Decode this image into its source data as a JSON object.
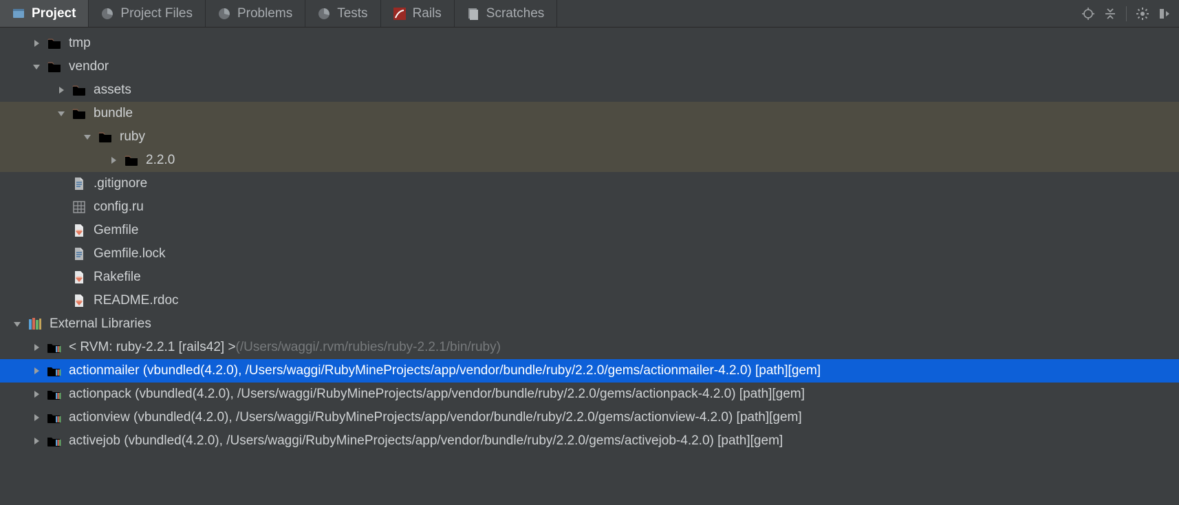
{
  "tabs": {
    "items": [
      {
        "label": "Project",
        "icon": "project-icon",
        "active": true
      },
      {
        "label": "Project Files",
        "icon": "pie-icon",
        "active": false
      },
      {
        "label": "Problems",
        "icon": "pie-icon",
        "active": false
      },
      {
        "label": "Tests",
        "icon": "pie-icon",
        "active": false
      },
      {
        "label": "Rails",
        "icon": "rails-icon",
        "active": false
      },
      {
        "label": "Scratches",
        "icon": "scratches-icon",
        "active": false
      }
    ]
  },
  "tree": {
    "rows": [
      {
        "indent": 1,
        "arrow": "right",
        "icon": "folder",
        "name": "tmp",
        "highlight": false
      },
      {
        "indent": 1,
        "arrow": "down",
        "icon": "folder",
        "name": "vendor",
        "highlight": false
      },
      {
        "indent": 2,
        "arrow": "right",
        "icon": "folder-yellow",
        "name": "assets",
        "highlight": false
      },
      {
        "indent": 2,
        "arrow": "down",
        "icon": "folder",
        "name": "bundle",
        "highlight": true
      },
      {
        "indent": 3,
        "arrow": "down",
        "icon": "folder",
        "name": "ruby",
        "highlight": true
      },
      {
        "indent": 4,
        "arrow": "right",
        "icon": "folder",
        "name": "2.2.0",
        "highlight": true
      },
      {
        "indent": 2,
        "arrow": "none",
        "icon": "file",
        "name": ".gitignore",
        "highlight": false
      },
      {
        "indent": 2,
        "arrow": "none",
        "icon": "grid",
        "name": "config.ru",
        "highlight": false
      },
      {
        "indent": 2,
        "arrow": "none",
        "icon": "gem",
        "name": "Gemfile",
        "highlight": false
      },
      {
        "indent": 2,
        "arrow": "none",
        "icon": "file",
        "name": "Gemfile.lock",
        "highlight": false
      },
      {
        "indent": 2,
        "arrow": "none",
        "icon": "gem",
        "name": "Rakefile",
        "highlight": false
      },
      {
        "indent": 2,
        "arrow": "none",
        "icon": "gem",
        "name": "README.rdoc",
        "highlight": false
      },
      {
        "indent": 0,
        "arrow": "down",
        "icon": "ext-libs",
        "name": "External Libraries",
        "highlight": false
      },
      {
        "indent": 1,
        "arrow": "right",
        "icon": "folder-lib",
        "name": "< RVM: ruby-2.2.1 [rails42] >",
        "suffix": " (/Users/waggi/.rvm/rubies/ruby-2.2.1/bin/ruby)",
        "highlight": false
      },
      {
        "indent": 1,
        "arrow": "right",
        "icon": "folder-lib",
        "name": "actionmailer (vbundled(4.2.0), /Users/waggi/RubyMineProjects/app/vendor/bundle/ruby/2.2.0/gems/actionmailer-4.2.0) [path][gem]",
        "selected": true
      },
      {
        "indent": 1,
        "arrow": "right",
        "icon": "folder-lib",
        "name": "actionpack (vbundled(4.2.0), /Users/waggi/RubyMineProjects/app/vendor/bundle/ruby/2.2.0/gems/actionpack-4.2.0) [path][gem]"
      },
      {
        "indent": 1,
        "arrow": "right",
        "icon": "folder-lib",
        "name": "actionview (vbundled(4.2.0), /Users/waggi/RubyMineProjects/app/vendor/bundle/ruby/2.2.0/gems/actionview-4.2.0) [path][gem]"
      },
      {
        "indent": 1,
        "arrow": "right",
        "icon": "folder-lib",
        "name": "activejob (vbundled(4.2.0), /Users/waggi/RubyMineProjects/app/vendor/bundle/ruby/2.2.0/gems/activejob-4.2.0) [path][gem]"
      }
    ]
  },
  "colors": {
    "bg": "#3c3f41",
    "text": "#cfd2d4",
    "dim": "#777a7c",
    "highlight": "#4e4c42",
    "selection": "#0d60d8",
    "folder_salmon": "#ce7b58",
    "folder_yellow": "#c8a35a"
  }
}
